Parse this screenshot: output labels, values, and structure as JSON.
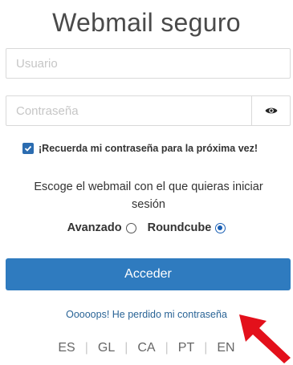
{
  "title": "Webmail seguro",
  "username": {
    "placeholder": "Usuario",
    "value": ""
  },
  "password": {
    "placeholder": "Contraseña",
    "value": "",
    "toggle_icon": "eye-icon"
  },
  "remember": {
    "label": "¡Recuerda mi contraseña para la próxima vez!",
    "checked": true
  },
  "webmail_prompt": "Escoge el webmail con el que quieras iniciar sesión",
  "webmail_options": [
    {
      "label": "Avanzado",
      "selected": false
    },
    {
      "label": "Roundcube",
      "selected": true
    }
  ],
  "submit_label": "Acceder",
  "forgot_link": "Ooooops! He perdido mi contraseña",
  "languages": [
    "ES",
    "GL",
    "CA",
    "PT",
    "EN"
  ],
  "separator": "|",
  "colors": {
    "primary_button": "#2f7bbf",
    "link": "#2a6496",
    "arrow": "#e3101b"
  }
}
